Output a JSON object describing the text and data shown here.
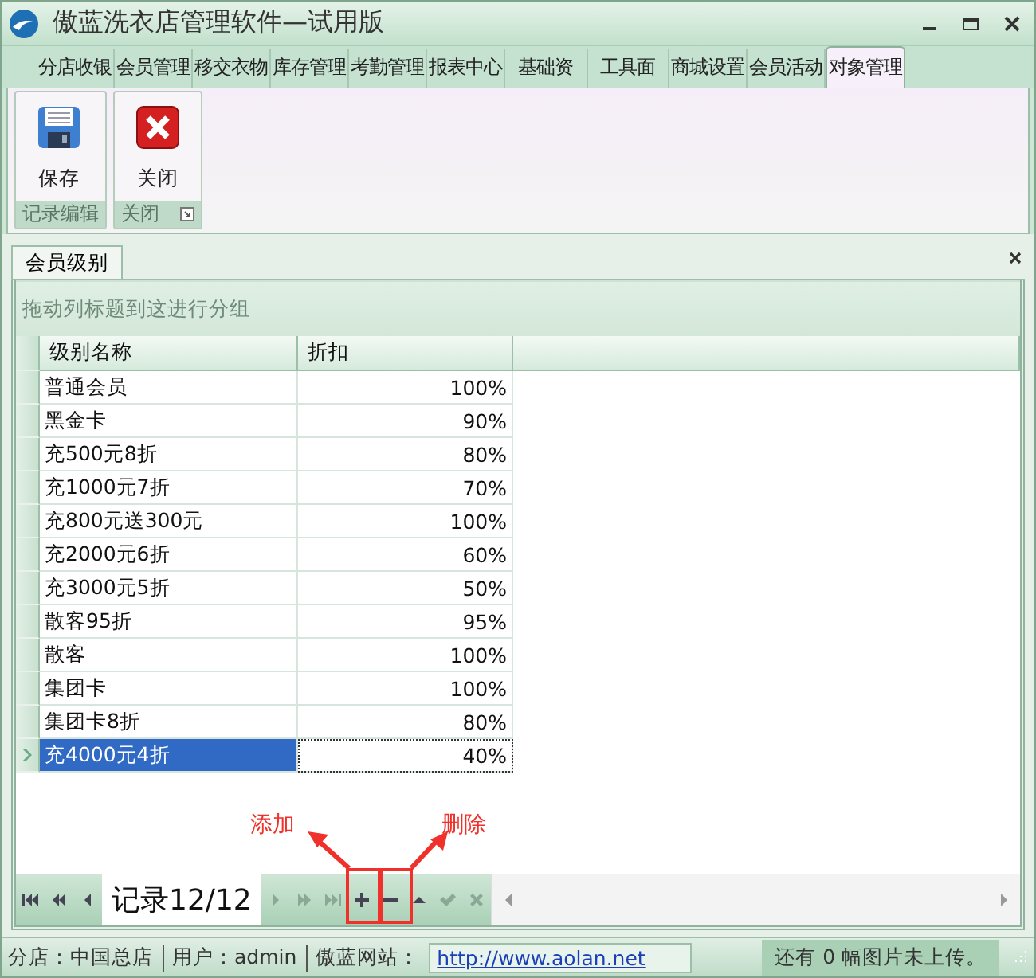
{
  "window": {
    "title": "傲蓝洗衣店管理软件—试用版"
  },
  "menu_tabs": [
    {
      "label": "分店收银",
      "selected": false
    },
    {
      "label": "会员管理",
      "selected": false
    },
    {
      "label": "移交衣物",
      "selected": false
    },
    {
      "label": "库存管理",
      "selected": false
    },
    {
      "label": "考勤管理",
      "selected": false
    },
    {
      "label": "报表中心",
      "selected": false
    },
    {
      "label": "基础资",
      "selected": false
    },
    {
      "label": "工具面",
      "selected": false
    },
    {
      "label": "商城设置",
      "selected": false
    },
    {
      "label": "会员活动",
      "selected": false
    },
    {
      "label": "对象管理",
      "selected": true
    }
  ],
  "ribbon_groups": [
    {
      "label": "记录编辑",
      "launcher": false,
      "buttons": [
        {
          "label": "保存",
          "kind": "save"
        }
      ]
    },
    {
      "label": "关闭",
      "launcher": true,
      "buttons": [
        {
          "label": "关闭",
          "kind": "close"
        }
      ]
    }
  ],
  "document_tab": {
    "label": "会员级别"
  },
  "group_panel": {
    "hint": "拖动列标题到这进行分组"
  },
  "table": {
    "columns": [
      "级别名称",
      "折扣"
    ],
    "rows": [
      {
        "cells": [
          "普通会员",
          "100%"
        ],
        "selected": false
      },
      {
        "cells": [
          "黑金卡",
          "90%"
        ],
        "selected": false
      },
      {
        "cells": [
          "充500元8折",
          "80%"
        ],
        "selected": false
      },
      {
        "cells": [
          "充1000元7折",
          "70%"
        ],
        "selected": false
      },
      {
        "cells": [
          "充800元送300元",
          "100%"
        ],
        "selected": false
      },
      {
        "cells": [
          "充2000元6折",
          "60%"
        ],
        "selected": false
      },
      {
        "cells": [
          "充3000元5折",
          "50%"
        ],
        "selected": false
      },
      {
        "cells": [
          "散客95折",
          "95%"
        ],
        "selected": false
      },
      {
        "cells": [
          "散客",
          "100%"
        ],
        "selected": false
      },
      {
        "cells": [
          "集团卡",
          "100%"
        ],
        "selected": false
      },
      {
        "cells": [
          "集团卡8折",
          "80%"
        ],
        "selected": false
      },
      {
        "cells": [
          "充4000元4折",
          "40%"
        ],
        "selected": true
      }
    ]
  },
  "navigator": {
    "record": "记录12/12",
    "buttons_before": [
      {
        "kind": "first",
        "disabled": false
      },
      {
        "kind": "prev-page",
        "disabled": false
      },
      {
        "kind": "prev",
        "disabled": false
      }
    ],
    "buttons_after": [
      {
        "kind": "next",
        "disabled": true
      },
      {
        "kind": "next-page",
        "disabled": true
      },
      {
        "kind": "last",
        "disabled": true
      },
      {
        "kind": "append",
        "disabled": false
      },
      {
        "kind": "delete",
        "disabled": false
      },
      {
        "kind": "edit",
        "disabled": false
      },
      {
        "kind": "post",
        "disabled": true
      },
      {
        "kind": "cancel",
        "disabled": true
      }
    ]
  },
  "annotations": [
    {
      "label": "添加"
    },
    {
      "label": "删除"
    }
  ],
  "status_bar": {
    "branch": "分店：中国总店",
    "user": "用户：admin",
    "site_label": "傲蓝网站：",
    "site_url": "http://www.aolan.net",
    "upload": "还有 0 幅图片未上传。"
  }
}
